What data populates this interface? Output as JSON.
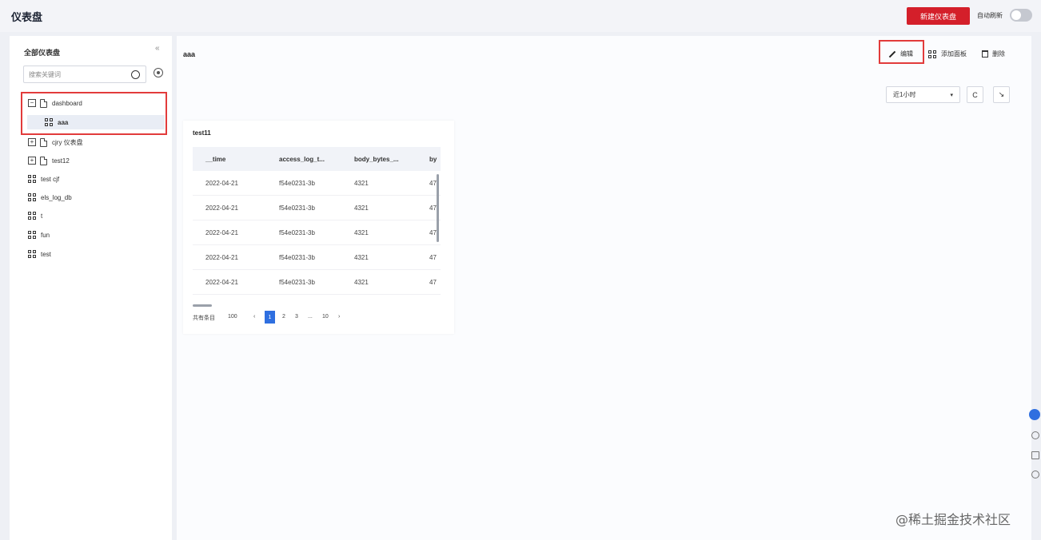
{
  "header": {
    "title": "仪表盘",
    "new_button_label": "新建仪表盘",
    "autorefresh_label": "自动刷新",
    "autorefresh_on": false
  },
  "sidebar": {
    "title": "全部仪表盘",
    "collapse_icon": "double-chevron-left-icon",
    "search_placeholder": "搜索关键词",
    "tree": [
      {
        "type": "folder",
        "expanded": true,
        "label": "dashboard"
      },
      {
        "type": "dashboard",
        "label": "aaa",
        "selected": true
      },
      {
        "type": "folder",
        "expanded": false,
        "label": "cjry 仪表盘"
      },
      {
        "type": "folder",
        "expanded": false,
        "label": "test12"
      },
      {
        "type": "dashboard",
        "label": "test cjf"
      },
      {
        "type": "dashboard",
        "label": "els_log_db"
      },
      {
        "type": "dashboard",
        "label": "t"
      },
      {
        "type": "dashboard",
        "label": "fun"
      },
      {
        "type": "dashboard",
        "label": "test"
      }
    ]
  },
  "main": {
    "dashboard_title": "aaa",
    "actions": {
      "edit": "编辑",
      "add_panel": "添加面板",
      "delete": "删除"
    },
    "time_range": "近1小时",
    "refresh_icon": "refresh-icon",
    "fullscreen_icon": "expand-icon"
  },
  "panel": {
    "title": "test11",
    "columns": [
      "__time",
      "access_log_t...",
      "body_bytes_...",
      "by"
    ],
    "rows": [
      [
        "2022-04-21",
        "f54e0231-3b",
        "4321",
        "47"
      ],
      [
        "2022-04-21",
        "f54e0231-3b",
        "4321",
        "47"
      ],
      [
        "2022-04-21",
        "f54e0231-3b",
        "4321",
        "47"
      ],
      [
        "2022-04-21",
        "f54e0231-3b",
        "4321",
        "47"
      ],
      [
        "2022-04-21",
        "f54e0231-3b",
        "4321",
        "47"
      ]
    ],
    "pagination": {
      "total_label": "共有条目",
      "total": "100",
      "prev": "‹",
      "pages": [
        "1",
        "2",
        "3"
      ],
      "current": "1",
      "ellipsis": "...",
      "last": "10",
      "next": "›"
    }
  },
  "watermark": "@稀土掘金技术社区",
  "colors": {
    "brand_red": "#d41f2a",
    "highlight_red": "#e23b3b",
    "accent_blue": "#2f6fe0"
  }
}
